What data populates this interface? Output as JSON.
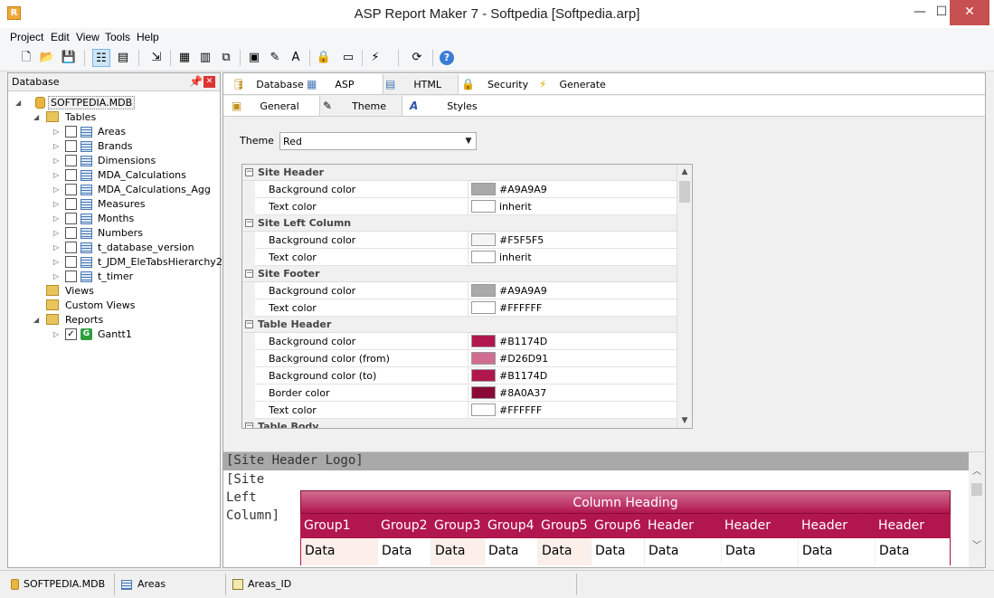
{
  "window": {
    "title": "ASP Report Maker 7 - Softpedia [Softpedia.arp]",
    "icon": "R",
    "minimize": "—",
    "maximize": "☐",
    "close": "✕"
  },
  "menu": [
    {
      "label": "Project"
    },
    {
      "label": "Edit"
    },
    {
      "label": "View"
    },
    {
      "label": "Tools"
    },
    {
      "label": "Help"
    }
  ],
  "toolbar": {
    "buttons": [
      {
        "icon": "new-file-icon",
        "glyph": "🗋"
      },
      {
        "icon": "open-folder-icon",
        "glyph": "📂"
      },
      {
        "icon": "save-icon",
        "glyph": "💾"
      },
      {
        "icon": "tree-view-icon",
        "glyph": "☷"
      },
      {
        "icon": "window-icon",
        "glyph": "▤"
      },
      {
        "icon": "database-arrow-icon",
        "glyph": "⇲"
      },
      {
        "icon": "table-add-icon",
        "glyph": "▦"
      },
      {
        "icon": "table-link-icon",
        "glyph": "▥"
      },
      {
        "icon": "copy-table-icon",
        "glyph": "⧉"
      },
      {
        "icon": "page-yellow-icon",
        "glyph": "▣"
      },
      {
        "icon": "edit-page-icon",
        "glyph": "✎"
      },
      {
        "icon": "font-style-icon",
        "glyph": "A"
      },
      {
        "icon": "lock-icon",
        "glyph": "🔒"
      },
      {
        "icon": "server-icon",
        "glyph": "▭"
      },
      {
        "icon": "lightning-icon",
        "glyph": "⚡"
      },
      {
        "icon": "refresh-icon",
        "glyph": "⟳"
      },
      {
        "icon": "help-icon",
        "glyph": "?"
      }
    ]
  },
  "database_panel": {
    "title": "Database",
    "pin": "📌",
    "close": "✕",
    "root": "SOFTPEDIA.MDB",
    "tables_label": "Tables",
    "tables": [
      "Areas",
      "Brands",
      "Dimensions",
      "MDA_Calculations",
      "MDA_Calculations_Agg",
      "Measures",
      "Months",
      "Numbers",
      "t_database_version",
      "t_JDM_EleTabsHierarchy2",
      "t_timer"
    ],
    "views_label": "Views",
    "custom_views_label": "Custom Views",
    "reports_label": "Reports",
    "reports": [
      {
        "name": "Gantt1",
        "checked": "✓",
        "badge": "G"
      }
    ]
  },
  "tabs_main": [
    {
      "label": "Database",
      "glyph": "🛢"
    },
    {
      "label": "ASP",
      "glyph": "▦"
    },
    {
      "label": "HTML",
      "glyph": "▤"
    },
    {
      "label": "Security",
      "glyph": "🔒"
    },
    {
      "label": "Generate",
      "glyph": "⚡"
    }
  ],
  "tabs_sub": [
    {
      "label": "General",
      "glyph": "▣"
    },
    {
      "label": "Theme",
      "glyph": "✎"
    },
    {
      "label": "Styles",
      "glyph": "A"
    }
  ],
  "theme": {
    "label": "Theme",
    "value": "Red"
  },
  "property_grid": [
    {
      "category": "Site Header",
      "rows": [
        {
          "name": "Background color",
          "value": "#A9A9A9",
          "color": "#A9A9A9"
        },
        {
          "name": "Text color",
          "value": "inherit",
          "color": "#FFFFFF"
        }
      ]
    },
    {
      "category": "Site Left Column",
      "rows": [
        {
          "name": "Background color",
          "value": "#F5F5F5",
          "color": "#F5F5F5"
        },
        {
          "name": "Text color",
          "value": "inherit",
          "color": "#FFFFFF"
        }
      ]
    },
    {
      "category": "Site Footer",
      "rows": [
        {
          "name": "Background color",
          "value": "#A9A9A9",
          "color": "#A9A9A9"
        },
        {
          "name": "Text color",
          "value": "#FFFFFF",
          "color": "#FFFFFF"
        }
      ]
    },
    {
      "category": "Table Header",
      "rows": [
        {
          "name": "Background color",
          "value": "#B1174D",
          "color": "#B1174D"
        },
        {
          "name": "Background color (from)",
          "value": "#D26D91",
          "color": "#D26D91"
        },
        {
          "name": "Background color (to)",
          "value": "#B1174D",
          "color": "#B1174D"
        },
        {
          "name": "Border color",
          "value": "#8A0A37",
          "color": "#8A0A37"
        },
        {
          "name": "Text color",
          "value": "#FFFFFF",
          "color": "#FFFFFF"
        }
      ]
    },
    {
      "category": "Table Body",
      "rows": []
    }
  ],
  "preview": {
    "site_header": "[Site Header Logo]",
    "left_column": [
      "[Site",
      "Left",
      "Column]"
    ],
    "column_heading": "Column Heading",
    "header_cells": [
      "Group1",
      "Group2",
      "Group3",
      "Group4",
      "Group5",
      "Group6",
      "Header",
      "Header",
      "Header",
      "Header"
    ],
    "data_cells": [
      "Data",
      "Data",
      "Data",
      "Data",
      "Data",
      "Data",
      "Data",
      "Data",
      "Data",
      "Data"
    ]
  },
  "statusbar": [
    {
      "label": "SOFTPEDIA.MDB",
      "icon": "database-icon"
    },
    {
      "label": "Areas",
      "icon": "table-icon"
    },
    {
      "label": "Areas_ID",
      "icon": "key-field-icon"
    }
  ]
}
